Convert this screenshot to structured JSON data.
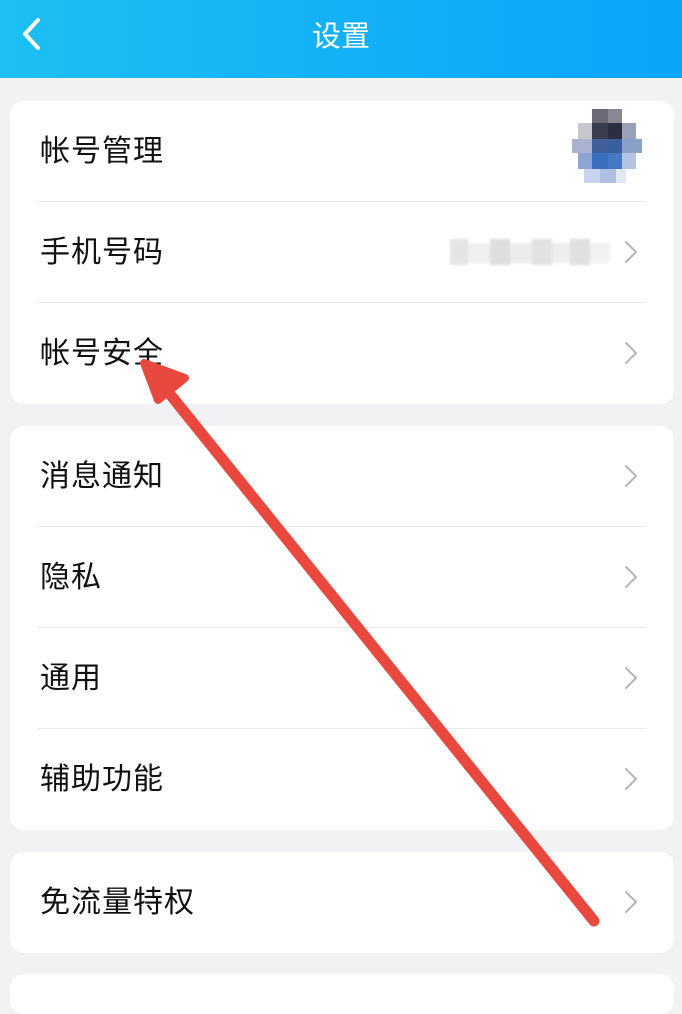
{
  "header": {
    "title": "设置",
    "back_icon": "chevron-left-icon",
    "background": "#12aef6"
  },
  "groups": [
    {
      "items": [
        {
          "label": "帐号管理",
          "trailing": "avatar"
        },
        {
          "label": "手机号码",
          "trailing": "chevron-right-icon"
        },
        {
          "label": "帐号安全",
          "trailing": "chevron-right-icon"
        }
      ]
    },
    {
      "items": [
        {
          "label": "消息通知",
          "trailing": "chevron-right-icon"
        },
        {
          "label": "隐私",
          "trailing": "chevron-right-icon"
        },
        {
          "label": "通用",
          "trailing": "chevron-right-icon"
        },
        {
          "label": "辅助功能",
          "trailing": "chevron-right-icon"
        }
      ]
    },
    {
      "items": [
        {
          "label": "免流量特权",
          "trailing": "chevron-right-icon"
        }
      ]
    }
  ],
  "annotation": {
    "arrow_color": "#e8483d"
  }
}
